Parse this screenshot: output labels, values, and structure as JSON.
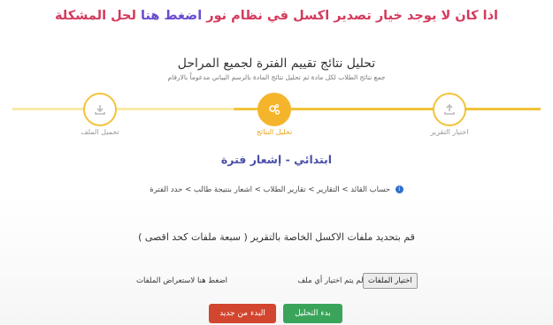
{
  "banner": {
    "prefix": "اذا كان لا يوجد خيار تصدير اكسل في نظام نور",
    "link_label": "اضغط هنا",
    "suffix": "لحل المشكلة"
  },
  "header": {
    "title": "تحليل نتائج تقييم الفترة لجميع المراحل",
    "subtitle": "جمع نتائج الطلاب لكل مادة ثم تحليل نتائج المادة بالرسم البياني مدعوماً بالارقام"
  },
  "stepper": {
    "steps": [
      {
        "label": "اختيار التقرير",
        "icon": "upload-icon",
        "state": "done"
      },
      {
        "label": "تحليل النتائج",
        "icon": "gears-icon",
        "state": "active"
      },
      {
        "label": "تحميل الملف",
        "icon": "download-icon",
        "state": "pending"
      }
    ]
  },
  "context": {
    "stage": "ابتدائي - إشعار فترة"
  },
  "breadcrumb": {
    "text": "حساب القائد > التقارير > تقارير الطلاب > اشعار بنتيجة طالب > حدد الفترة"
  },
  "instruction": {
    "text": "قم بتحديد ملفات الاكسل الخاصة بالتقرير ( سبعة ملفات كحد اقصى )"
  },
  "upload": {
    "button_label": "اختيار الملفات",
    "status": "لم يتم اختيار أي ملف",
    "hint": "اضغط هنا لاستعراض الملفات"
  },
  "actions": {
    "start_label": "بدء التحليل",
    "reset_label": "البدء من جديد"
  },
  "colors": {
    "banner_red": "#d43a5c",
    "link_purple": "#6b4bd1",
    "step_accent": "#f5b52b",
    "start_green": "#3aa55a",
    "reset_red": "#d2452f"
  }
}
